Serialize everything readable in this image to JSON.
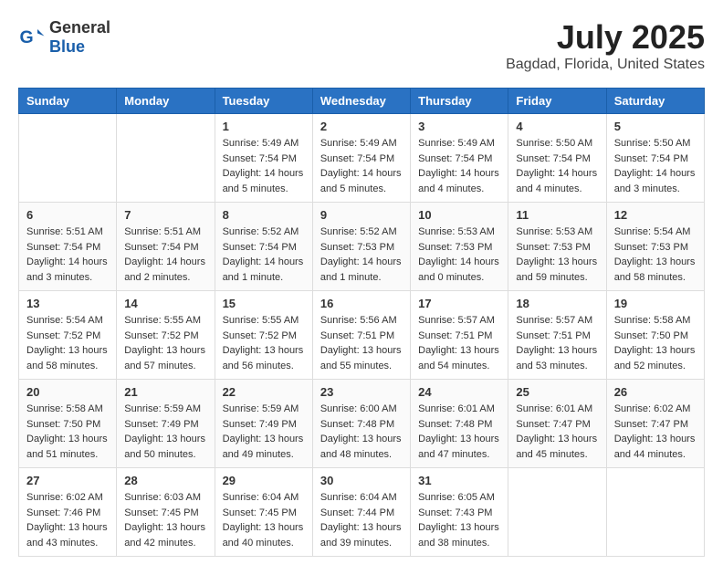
{
  "header": {
    "logo_general": "General",
    "logo_blue": "Blue",
    "month_year": "July 2025",
    "location": "Bagdad, Florida, United States"
  },
  "weekdays": [
    "Sunday",
    "Monday",
    "Tuesday",
    "Wednesday",
    "Thursday",
    "Friday",
    "Saturday"
  ],
  "weeks": [
    [
      {
        "day": "",
        "sunrise": "",
        "sunset": "",
        "daylight": ""
      },
      {
        "day": "",
        "sunrise": "",
        "sunset": "",
        "daylight": ""
      },
      {
        "day": "1",
        "sunrise": "Sunrise: 5:49 AM",
        "sunset": "Sunset: 7:54 PM",
        "daylight": "Daylight: 14 hours and 5 minutes."
      },
      {
        "day": "2",
        "sunrise": "Sunrise: 5:49 AM",
        "sunset": "Sunset: 7:54 PM",
        "daylight": "Daylight: 14 hours and 5 minutes."
      },
      {
        "day": "3",
        "sunrise": "Sunrise: 5:49 AM",
        "sunset": "Sunset: 7:54 PM",
        "daylight": "Daylight: 14 hours and 4 minutes."
      },
      {
        "day": "4",
        "sunrise": "Sunrise: 5:50 AM",
        "sunset": "Sunset: 7:54 PM",
        "daylight": "Daylight: 14 hours and 4 minutes."
      },
      {
        "day": "5",
        "sunrise": "Sunrise: 5:50 AM",
        "sunset": "Sunset: 7:54 PM",
        "daylight": "Daylight: 14 hours and 3 minutes."
      }
    ],
    [
      {
        "day": "6",
        "sunrise": "Sunrise: 5:51 AM",
        "sunset": "Sunset: 7:54 PM",
        "daylight": "Daylight: 14 hours and 3 minutes."
      },
      {
        "day": "7",
        "sunrise": "Sunrise: 5:51 AM",
        "sunset": "Sunset: 7:54 PM",
        "daylight": "Daylight: 14 hours and 2 minutes."
      },
      {
        "day": "8",
        "sunrise": "Sunrise: 5:52 AM",
        "sunset": "Sunset: 7:54 PM",
        "daylight": "Daylight: 14 hours and 1 minute."
      },
      {
        "day": "9",
        "sunrise": "Sunrise: 5:52 AM",
        "sunset": "Sunset: 7:53 PM",
        "daylight": "Daylight: 14 hours and 1 minute."
      },
      {
        "day": "10",
        "sunrise": "Sunrise: 5:53 AM",
        "sunset": "Sunset: 7:53 PM",
        "daylight": "Daylight: 14 hours and 0 minutes."
      },
      {
        "day": "11",
        "sunrise": "Sunrise: 5:53 AM",
        "sunset": "Sunset: 7:53 PM",
        "daylight": "Daylight: 13 hours and 59 minutes."
      },
      {
        "day": "12",
        "sunrise": "Sunrise: 5:54 AM",
        "sunset": "Sunset: 7:53 PM",
        "daylight": "Daylight: 13 hours and 58 minutes."
      }
    ],
    [
      {
        "day": "13",
        "sunrise": "Sunrise: 5:54 AM",
        "sunset": "Sunset: 7:52 PM",
        "daylight": "Daylight: 13 hours and 58 minutes."
      },
      {
        "day": "14",
        "sunrise": "Sunrise: 5:55 AM",
        "sunset": "Sunset: 7:52 PM",
        "daylight": "Daylight: 13 hours and 57 minutes."
      },
      {
        "day": "15",
        "sunrise": "Sunrise: 5:55 AM",
        "sunset": "Sunset: 7:52 PM",
        "daylight": "Daylight: 13 hours and 56 minutes."
      },
      {
        "day": "16",
        "sunrise": "Sunrise: 5:56 AM",
        "sunset": "Sunset: 7:51 PM",
        "daylight": "Daylight: 13 hours and 55 minutes."
      },
      {
        "day": "17",
        "sunrise": "Sunrise: 5:57 AM",
        "sunset": "Sunset: 7:51 PM",
        "daylight": "Daylight: 13 hours and 54 minutes."
      },
      {
        "day": "18",
        "sunrise": "Sunrise: 5:57 AM",
        "sunset": "Sunset: 7:51 PM",
        "daylight": "Daylight: 13 hours and 53 minutes."
      },
      {
        "day": "19",
        "sunrise": "Sunrise: 5:58 AM",
        "sunset": "Sunset: 7:50 PM",
        "daylight": "Daylight: 13 hours and 52 minutes."
      }
    ],
    [
      {
        "day": "20",
        "sunrise": "Sunrise: 5:58 AM",
        "sunset": "Sunset: 7:50 PM",
        "daylight": "Daylight: 13 hours and 51 minutes."
      },
      {
        "day": "21",
        "sunrise": "Sunrise: 5:59 AM",
        "sunset": "Sunset: 7:49 PM",
        "daylight": "Daylight: 13 hours and 50 minutes."
      },
      {
        "day": "22",
        "sunrise": "Sunrise: 5:59 AM",
        "sunset": "Sunset: 7:49 PM",
        "daylight": "Daylight: 13 hours and 49 minutes."
      },
      {
        "day": "23",
        "sunrise": "Sunrise: 6:00 AM",
        "sunset": "Sunset: 7:48 PM",
        "daylight": "Daylight: 13 hours and 48 minutes."
      },
      {
        "day": "24",
        "sunrise": "Sunrise: 6:01 AM",
        "sunset": "Sunset: 7:48 PM",
        "daylight": "Daylight: 13 hours and 47 minutes."
      },
      {
        "day": "25",
        "sunrise": "Sunrise: 6:01 AM",
        "sunset": "Sunset: 7:47 PM",
        "daylight": "Daylight: 13 hours and 45 minutes."
      },
      {
        "day": "26",
        "sunrise": "Sunrise: 6:02 AM",
        "sunset": "Sunset: 7:47 PM",
        "daylight": "Daylight: 13 hours and 44 minutes."
      }
    ],
    [
      {
        "day": "27",
        "sunrise": "Sunrise: 6:02 AM",
        "sunset": "Sunset: 7:46 PM",
        "daylight": "Daylight: 13 hours and 43 minutes."
      },
      {
        "day": "28",
        "sunrise": "Sunrise: 6:03 AM",
        "sunset": "Sunset: 7:45 PM",
        "daylight": "Daylight: 13 hours and 42 minutes."
      },
      {
        "day": "29",
        "sunrise": "Sunrise: 6:04 AM",
        "sunset": "Sunset: 7:45 PM",
        "daylight": "Daylight: 13 hours and 40 minutes."
      },
      {
        "day": "30",
        "sunrise": "Sunrise: 6:04 AM",
        "sunset": "Sunset: 7:44 PM",
        "daylight": "Daylight: 13 hours and 39 minutes."
      },
      {
        "day": "31",
        "sunrise": "Sunrise: 6:05 AM",
        "sunset": "Sunset: 7:43 PM",
        "daylight": "Daylight: 13 hours and 38 minutes."
      },
      {
        "day": "",
        "sunrise": "",
        "sunset": "",
        "daylight": ""
      },
      {
        "day": "",
        "sunrise": "",
        "sunset": "",
        "daylight": ""
      }
    ]
  ]
}
